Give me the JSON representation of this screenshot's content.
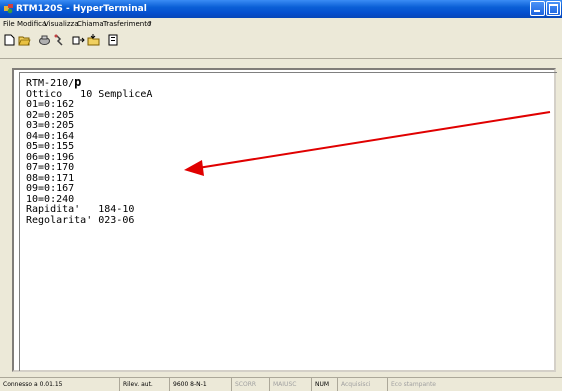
{
  "window": {
    "title": "RTM120S - HyperTerminal"
  },
  "menu": [
    "File",
    "Modifica",
    "Visualizza",
    "Chiama",
    "Trasferimento",
    "?"
  ],
  "toolbar": [
    "new-icon",
    "open-icon",
    "phone-icon",
    "disconnect-icon",
    "send-icon",
    "receive-icon",
    "properties-icon"
  ],
  "terminal": {
    "header": "RTM-210/",
    "header_cursor": "p",
    "lines": [
      "Ottico   10 SempliceA",
      "01=0:162",
      "02=0:205",
      "03=0:205",
      "04=0:164",
      "05=0:155",
      "06=0:196",
      "07=0:170",
      "08=0:171",
      "09=0:167",
      "10=0:240",
      "Rapidita'   184-10",
      "Regolarita' 023-06"
    ]
  },
  "status": {
    "connection": "Connesso a 0.01.15",
    "detect": "Rilev. aut.",
    "params": "9600 8-N-1",
    "scroll": "SCORR",
    "caps": "MAIUSC",
    "num": "NUM",
    "capture": "Acquisisci",
    "echo": "Eco stampante"
  },
  "colors": {
    "titlebar": "#0a5fd6",
    "arrow": "#e00000"
  }
}
